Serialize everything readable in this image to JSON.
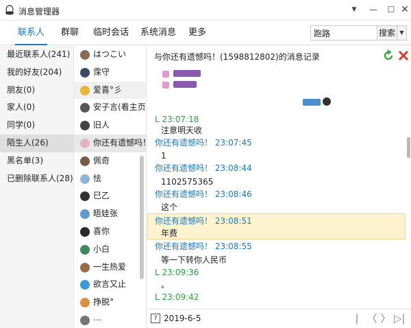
{
  "window": {
    "title": "消息管理器",
    "controls": {
      "menu": "▼",
      "minimize": "—",
      "maximize": "☐",
      "close": "✕"
    }
  },
  "nav": {
    "tabs": [
      {
        "label": "联系人",
        "active": true
      },
      {
        "label": "群聊",
        "active": false
      },
      {
        "label": "临时会话",
        "active": false
      },
      {
        "label": "系统消息",
        "active": false
      },
      {
        "label": "更多",
        "active": false
      }
    ],
    "search_value": "跑路",
    "search_button": "搜索",
    "search_dropdown": "▼"
  },
  "groups": [
    {
      "label": "最近联系人(241)",
      "selected": false
    },
    {
      "label": "我的好友(204)",
      "selected": false
    },
    {
      "label": "朋友(0)",
      "selected": false
    },
    {
      "label": "家人(0)",
      "selected": false
    },
    {
      "label": "同学(0)",
      "selected": false
    },
    {
      "label": "陌生人(26)",
      "selected": true
    },
    {
      "label": "黑名单(3)",
      "selected": false
    },
    {
      "label": "已删除联系人(28)",
      "selected": false
    }
  ],
  "contacts": [
    {
      "name": "はつこい",
      "avatar_color": "#8a6a55"
    },
    {
      "name": "霂守",
      "avatar_color": "#3c4a68"
    },
    {
      "name": "爱喜°彡",
      "avatar_color": "#e8b830"
    },
    {
      "name": "安子言(看主页...",
      "avatar_color": "#555555"
    },
    {
      "name": "旧人",
      "avatar_color": "#444444"
    },
    {
      "name": "你还有遗憾吗！",
      "avatar_color": "#e4b4c4"
    },
    {
      "name": "佩奇",
      "avatar_color": "#7a5a48"
    },
    {
      "name": "怯",
      "avatar_color": "#8fb4d8"
    },
    {
      "name": "巳乙",
      "avatar_color": "#333333"
    },
    {
      "name": "晤娃张",
      "avatar_color": "#5c9ad0"
    },
    {
      "name": "喜你",
      "avatar_color": "#2a2a2a"
    },
    {
      "name": "小白",
      "avatar_color": "#3a8a5a"
    },
    {
      "name": "一生热爱",
      "avatar_color": "#9a6a4a"
    },
    {
      "name": "欲言又止",
      "avatar_color": "#3a9ad8"
    },
    {
      "name": "挣脱°",
      "avatar_color": "#d89040"
    },
    {
      "name": "⋯",
      "avatar_color": "#777777"
    }
  ],
  "chat": {
    "title": "与你还有遗憾吗！(1598812802)的消息记录",
    "messages": [
      {
        "sender": "L",
        "time": "23:07:18",
        "text": "注意明天收",
        "self": true
      },
      {
        "sender": "你还有遗憾吗！",
        "time": "23:07:45",
        "text": "1",
        "self": false
      },
      {
        "sender": "你还有遗憾吗！",
        "time": "23:08:44",
        "text": "1102575365",
        "self": false
      },
      {
        "sender": "你还有遗憾吗！",
        "time": "23:08:46",
        "text": "这个",
        "self": false
      },
      {
        "sender": "你还有遗憾吗！",
        "time": "23:08:51",
        "text": "年费",
        "self": false,
        "highlighted": true
      },
      {
        "sender": "你还有遗憾吗！",
        "time": "23:08:55",
        "text": "等一下转你人民币",
        "self": false
      },
      {
        "sender": "L",
        "time": "23:09:36",
        "text": "。",
        "self": true
      },
      {
        "sender": "L",
        "time": "23:09:42",
        "text": "",
        "self": true
      }
    ]
  },
  "footer": {
    "calendar_icon": "7",
    "date": "2019-6-5",
    "pager": {
      "first": "|◁",
      "prev": "〈",
      "next": "〉",
      "last": "▷|"
    }
  },
  "colors": {
    "accent": "#1a78c2",
    "self_sender": "#26a340",
    "highlight": "#fdf3cf"
  }
}
